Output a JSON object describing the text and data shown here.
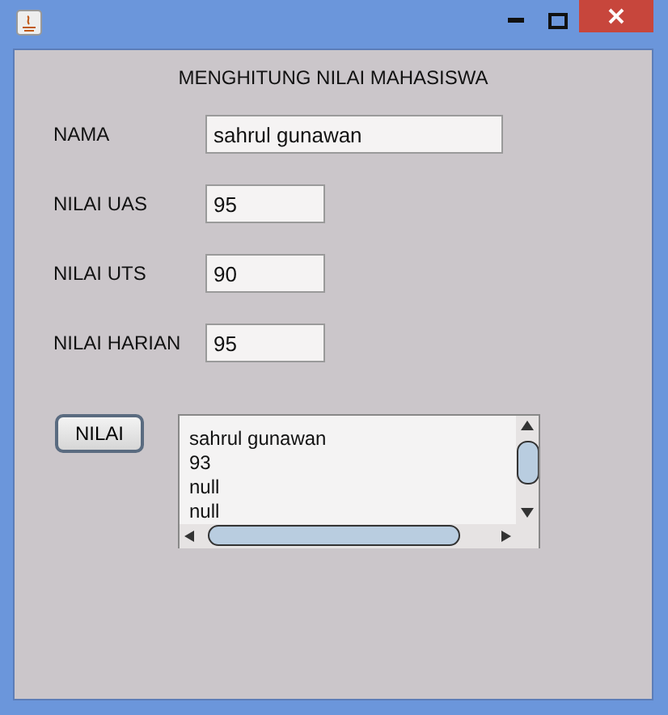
{
  "heading": "MENGHITUNG NILAI MAHASISWA",
  "fields": [
    {
      "label": "NAMA",
      "value": "sahrul gunawan",
      "kind": "wide"
    },
    {
      "label": "NILAI UAS",
      "value": "95",
      "kind": "short"
    },
    {
      "label": "NILAI UTS",
      "value": "90",
      "kind": "short"
    },
    {
      "label": "NILAI HARIAN",
      "value": "95",
      "kind": "short"
    }
  ],
  "button": "NILAI",
  "output_lines": [
    "sahrul gunawan",
    "93",
    "null",
    "null"
  ]
}
